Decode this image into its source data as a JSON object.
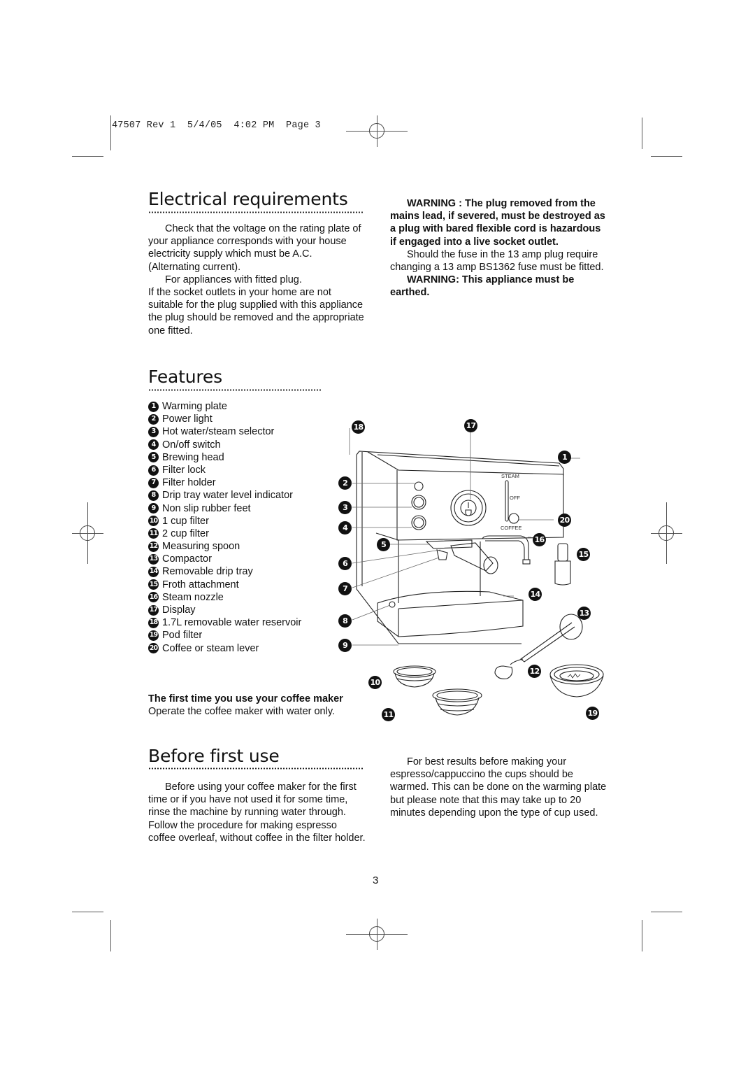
{
  "slug": "47507 Rev 1  5/4/05  4:02 PM  Page 3",
  "electrical": {
    "title": "Electrical requirements",
    "paragraphs": [
      "Check that the voltage on the rating plate of your appliance corresponds with your house electricity supply which must be A.C. (Alternating current).",
      "For appliances with fitted plug.",
      "If the socket outlets in your home are not suitable for the plug supplied with this appliance the plug should be removed and the appropriate one fitted."
    ],
    "warning1": "WARNING : The plug removed from the mains lead, if severed, must be destroyed as a plug with bared flexible cord is hazardous if engaged into a live socket outlet.",
    "fuse_note": "Should the fuse in the 13 amp plug require changing a 13 amp BS1362 fuse must be fitted.",
    "warning2": "WARNING: This appliance must be earthed."
  },
  "features": {
    "title": "Features",
    "items": [
      {
        "num": "1",
        "label": "Warming plate"
      },
      {
        "num": "2",
        "label": "Power light"
      },
      {
        "num": "3",
        "label": "Hot water/steam selector"
      },
      {
        "num": "4",
        "label": "On/off switch"
      },
      {
        "num": "5",
        "label": "Brewing head"
      },
      {
        "num": "6",
        "label": "Filter lock"
      },
      {
        "num": "7",
        "label": "Filter holder"
      },
      {
        "num": "8",
        "label": "Drip tray water level indicator"
      },
      {
        "num": "9",
        "label": "Non slip rubber feet"
      },
      {
        "num": "10",
        "label": "1 cup filter"
      },
      {
        "num": "11",
        "label": "2 cup filter"
      },
      {
        "num": "12",
        "label": "Measuring spoon"
      },
      {
        "num": "13",
        "label": "Compactor"
      },
      {
        "num": "14",
        "label": "Removable drip tray"
      },
      {
        "num": "15",
        "label": "Froth attachment"
      },
      {
        "num": "16",
        "label": "Steam nozzle"
      },
      {
        "num": "17",
        "label": "Display"
      },
      {
        "num": "18",
        "label": "1.7L removable water reservoir"
      },
      {
        "num": "19",
        "label": "Pod filter"
      },
      {
        "num": "20",
        "label": "Coffee or steam lever"
      }
    ],
    "first_time_heading": "The first time you use your coffee maker",
    "first_time_text": "Operate the coffee maker with water only.",
    "diagram_labels": {
      "steam": "STEAM",
      "off": "OFF",
      "coffee": "COFFEE"
    }
  },
  "before_first_use": {
    "title": "Before first use",
    "left_text": "Before using your coffee maker for the first time or if you have not used it for some time, rinse the machine by running water through. Follow the procedure for making espresso coffee overleaf, without coffee in the filter holder.",
    "right_text": "For best results before making your espresso/cappuccino the cups should be warmed. This can be done on the warming plate but please note that this may take up to 20 minutes depending upon the type of cup used."
  },
  "page_number": "3"
}
